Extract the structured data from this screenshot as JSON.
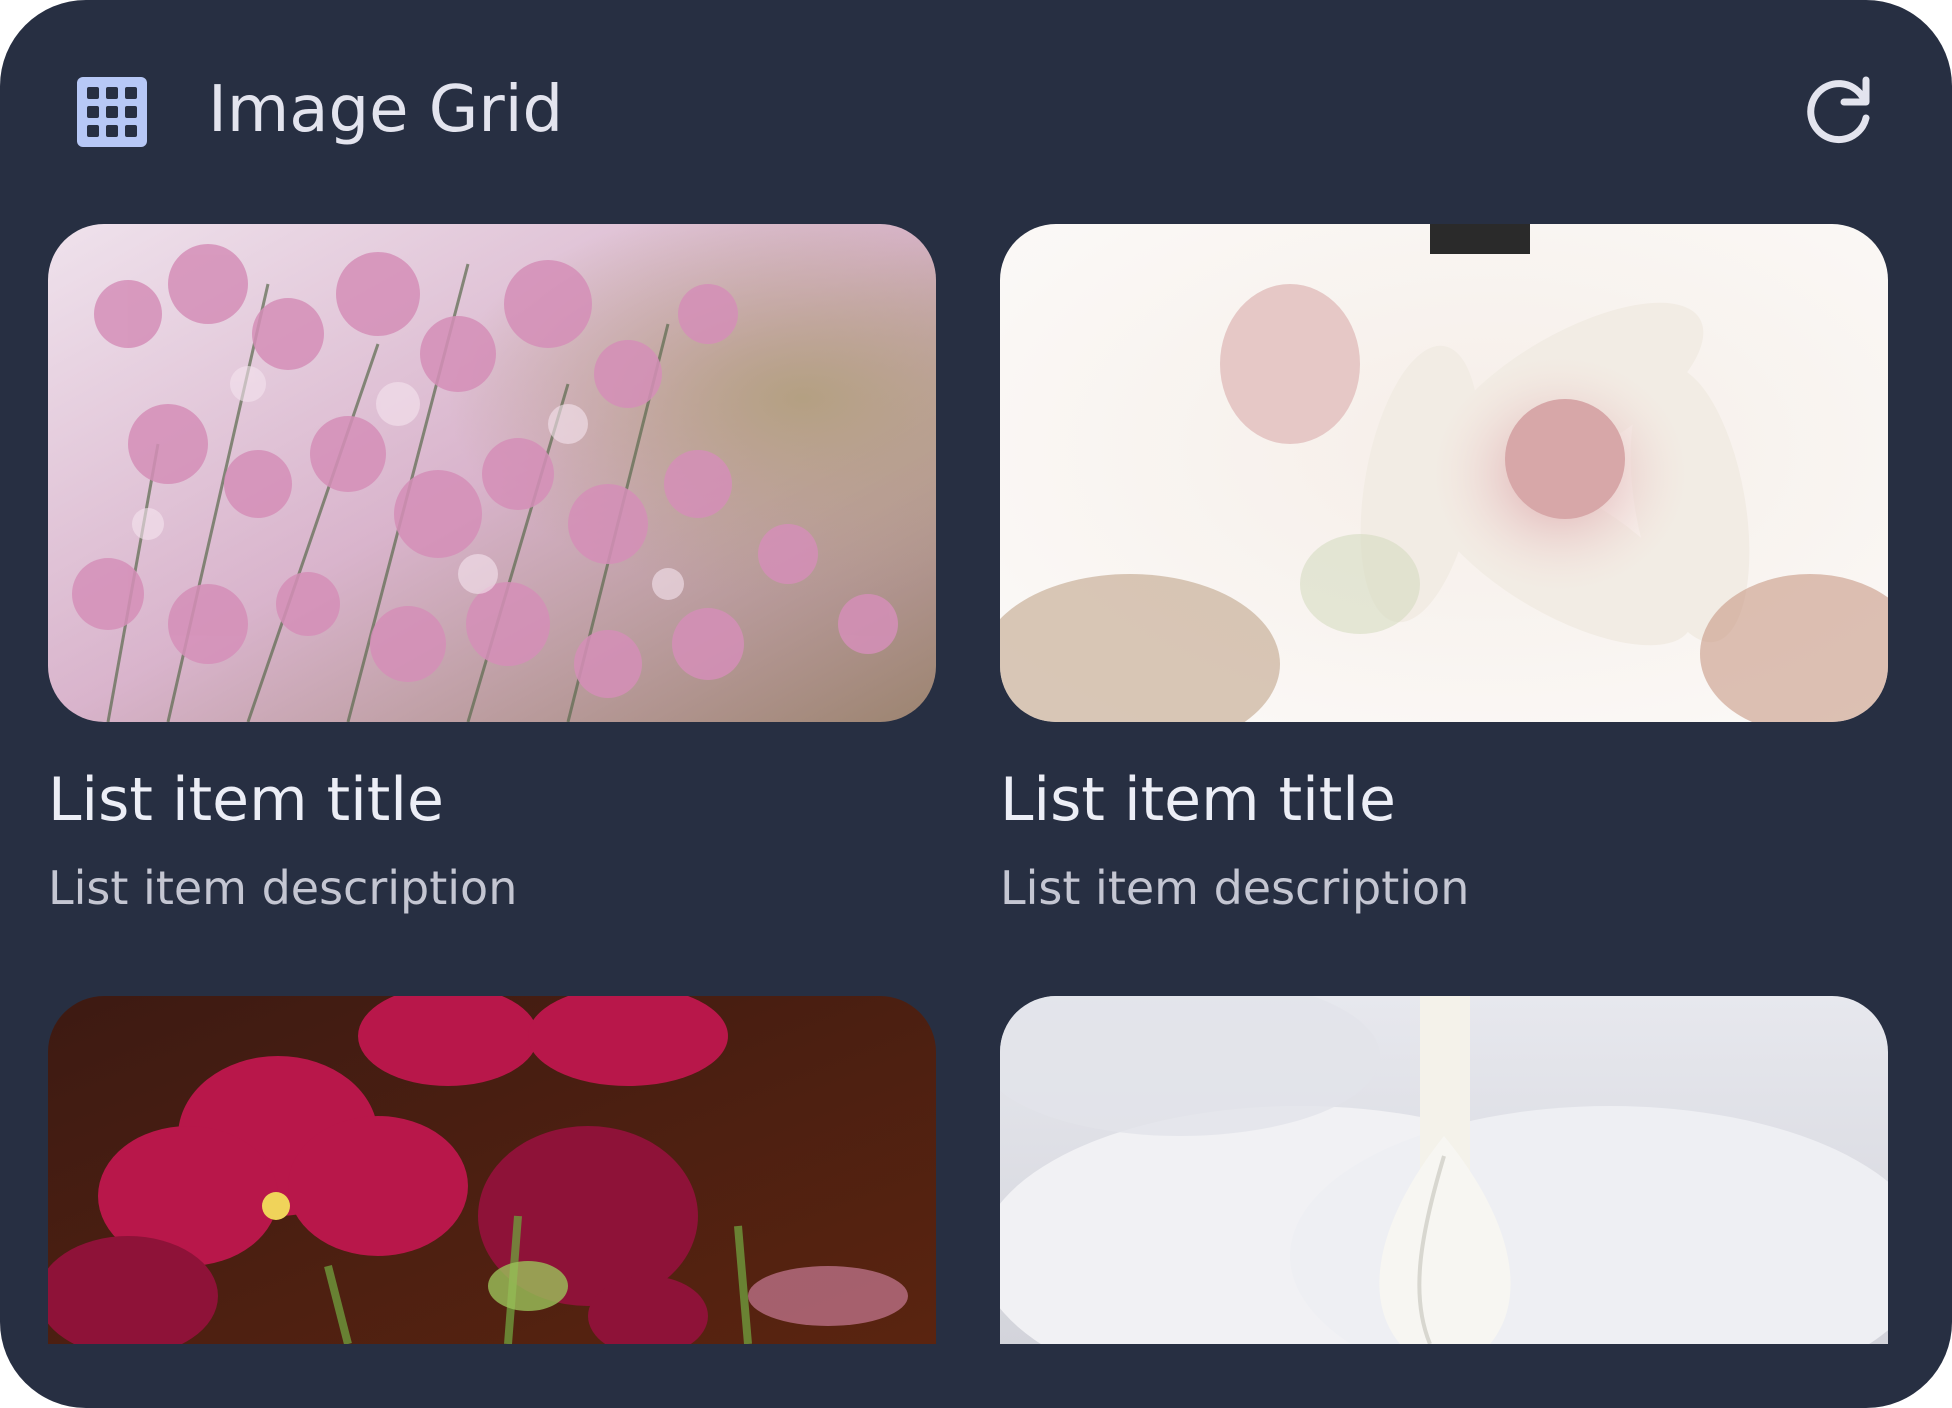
{
  "header": {
    "title": "Image Grid",
    "icon": "grid-icon",
    "refresh_icon": "refresh-icon",
    "accent_color": "#b7c8f6"
  },
  "items": [
    {
      "title": "List item title",
      "description": "List item description",
      "image": "pink-limonium-flowers"
    },
    {
      "title": "List item title",
      "description": "List item description",
      "image": "white-pink-blushing-bride-flower"
    },
    {
      "image": "magenta-pansy-flowers"
    },
    {
      "image": "white-orchid-closeup"
    }
  ]
}
